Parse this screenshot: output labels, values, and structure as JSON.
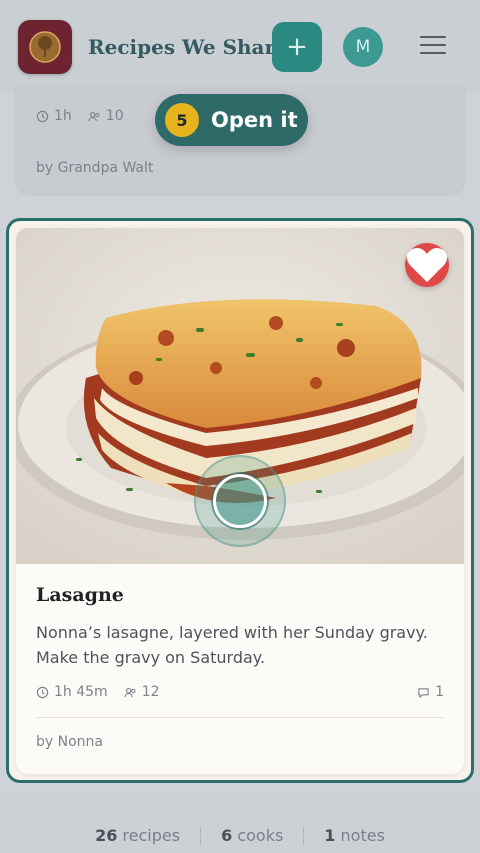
{
  "header": {
    "app_title": "Recipes We Share",
    "add_label": "+",
    "avatar_initial": "M"
  },
  "previous_card": {
    "time": "1h",
    "servings": "10",
    "author": "by Grandpa Walt"
  },
  "step": {
    "number": "5",
    "label": "Open it"
  },
  "card": {
    "title": "Lasagne",
    "description": "Nonna’s lasagne, layered with her Sunday gravy. Make the gravy on Saturday.",
    "time": "1h 45m",
    "servings": "12",
    "comments": "1",
    "author": "by Nonna",
    "favorite_icon": "heart-icon"
  },
  "stats": {
    "recipes_count": "26",
    "recipes_label": "recipes",
    "cooks_count": "6",
    "cooks_label": "cooks",
    "notes_count": "1",
    "notes_label": "notes"
  },
  "colors": {
    "accent": "#2a8a82",
    "highlight_border": "#2a6f6c",
    "favorite": "#e04848",
    "step_badge": "#e7b420"
  }
}
